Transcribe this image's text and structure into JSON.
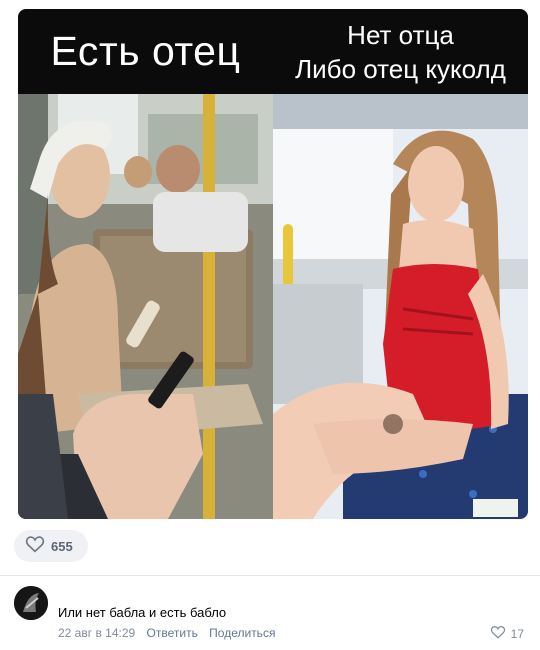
{
  "meme": {
    "caption_left": "Есть отец",
    "caption_right_line1": "Нет отца",
    "caption_right_line2": "Либо отец куколд"
  },
  "post": {
    "likes": "655"
  },
  "comment": {
    "text": "Или нет бабла и есть бабло",
    "date": "22 авг в 14:29",
    "reply_label": "Ответить",
    "share_label": "Поделиться",
    "likes": "17"
  },
  "icons": {
    "like": "heart-icon",
    "comment_like": "heart-icon"
  },
  "colors": {
    "link": "#5f7896",
    "meta": "#818c99",
    "pill": "#eff1f4"
  }
}
